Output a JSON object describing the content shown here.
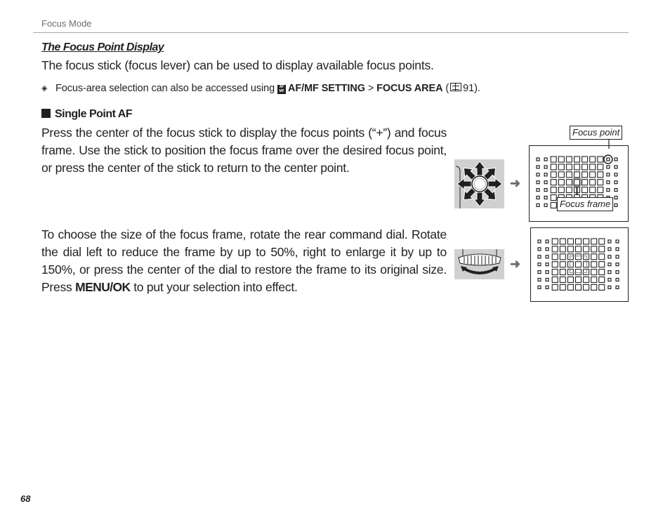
{
  "header": {
    "running_head": "Focus Mode"
  },
  "section": {
    "title": "The Focus Point Display",
    "intro": "The focus stick (focus lever) can be used to display available focus points."
  },
  "note": {
    "icon": "note-tag-icon",
    "text_before": "Focus-area selection can also be accessed using",
    "menu_icon": "af-mf-menu-icon",
    "menu_icon_text": "AF MF",
    "menu_path_1": "AF/MF SETTING",
    "separator": ">",
    "menu_path_2": "FOCUS AREA",
    "ref_open": "(",
    "ref_icon": "book-icon",
    "ref_page": "91",
    "ref_close": ")."
  },
  "single_point": {
    "heading": "Single Point AF",
    "para1": "Press the center of the focus stick to display the focus points (“+”) and focus frame.  Use the stick to position the focus frame over the desired focus point, or press the center of the stick to return to the center point.",
    "para2_before": "To choose the size of the focus frame, rotate the rear command dial. Rotate the dial left to reduce the frame by up to 50%, right to enlarge it by up to 150%, or press the center of the dial to restore the frame to its original size.  Press",
    "para2_button": "MENU/OK",
    "para2_after": "to put your selection into effect."
  },
  "figures": {
    "figure1": {
      "control": "focus-stick-icon",
      "arrow": "➜",
      "callout_point": "Focus point",
      "callout_frame": "Focus frame",
      "grid": {
        "rows": 7,
        "cols": 11,
        "small_cols": [
          0,
          1,
          9,
          10
        ],
        "frame_at": [
          3,
          5
        ],
        "highlight_point": [
          0,
          9
        ]
      }
    },
    "figure2": {
      "control": "command-dial-icon",
      "arrow": "➜",
      "grid": {
        "rows": 7,
        "cols": 11,
        "small_cols": [
          0,
          1,
          9,
          10
        ],
        "frame_at": [
          3,
          5
        ],
        "frame_scale": 2
      }
    }
  },
  "footer": {
    "page_number": "68"
  }
}
